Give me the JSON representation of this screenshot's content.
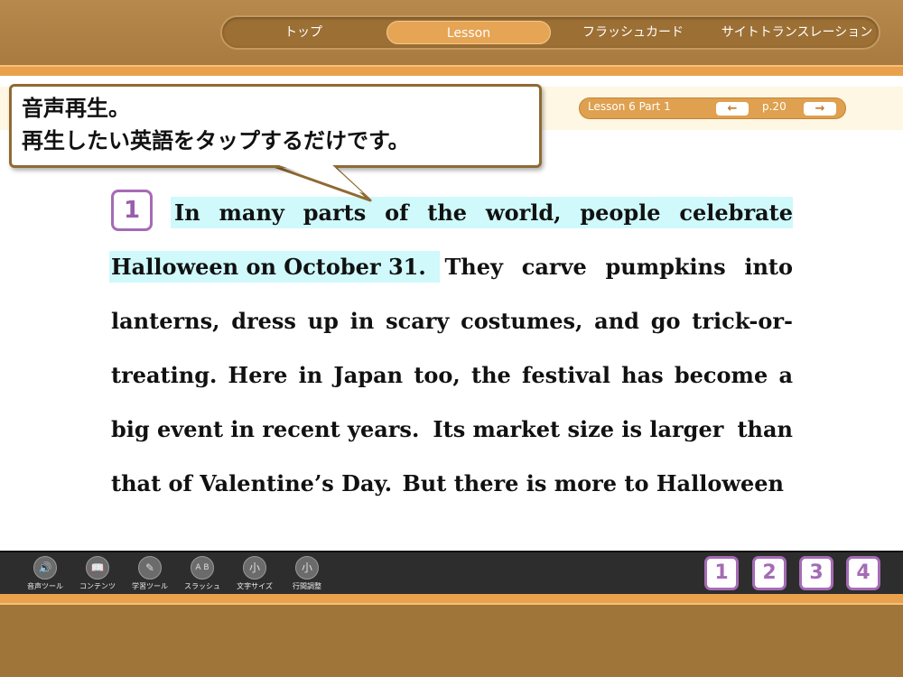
{
  "nav": {
    "items": [
      "トップ",
      "Lesson",
      "フラッシュカード",
      "サイトトランスレーション"
    ],
    "active": "Lesson"
  },
  "lesson": {
    "label": "Lesson 6 Part 1",
    "prev_icon": "arrow-left-icon",
    "next_icon": "arrow-right-icon",
    "page": "p.20"
  },
  "callout": {
    "line1": "音声再生。",
    "line2": "再生したい英語をタップするだけです。"
  },
  "paragraph": {
    "number": "1",
    "lines": [
      [
        "In",
        "many",
        "parts",
        "of",
        "the",
        "world,",
        "people",
        "celebrate"
      ],
      [
        "Halloween  on October 31.",
        "They",
        "carve",
        "pumpkins",
        "into"
      ],
      [
        "lanterns,",
        "dress",
        "up",
        "in",
        "scary",
        "costumes,",
        "and",
        "go",
        "trick-or-"
      ],
      [
        "treating.",
        "Here",
        "in",
        "Japan",
        "too,",
        "the",
        "festival",
        "has",
        "become",
        "a"
      ],
      [
        "big event  in recent years.",
        "Its market size is larger",
        "than"
      ],
      [
        "that of Valentine’s Day.",
        "But there is more to Halloween"
      ]
    ]
  },
  "toolbar": {
    "tools": [
      {
        "label": "音声ツール",
        "icon": "speaker-icon"
      },
      {
        "label": "コンテンツ",
        "icon": "book-icon"
      },
      {
        "label": "学習ツール",
        "icon": "study-tool-icon"
      },
      {
        "label": "スラッシュ",
        "icon": "slash-icon",
        "glyph": "A B"
      },
      {
        "label": "文字サイズ",
        "icon": "font-size-icon",
        "glyph": "小"
      },
      {
        "label": "行間調整",
        "icon": "line-spacing-icon",
        "glyph": "小"
      }
    ],
    "pages": [
      "1",
      "2",
      "3",
      "4"
    ]
  },
  "colors": {
    "accent": "#e9a14e",
    "highlight": "#cff9fb",
    "number_border": "#a56bb5"
  }
}
